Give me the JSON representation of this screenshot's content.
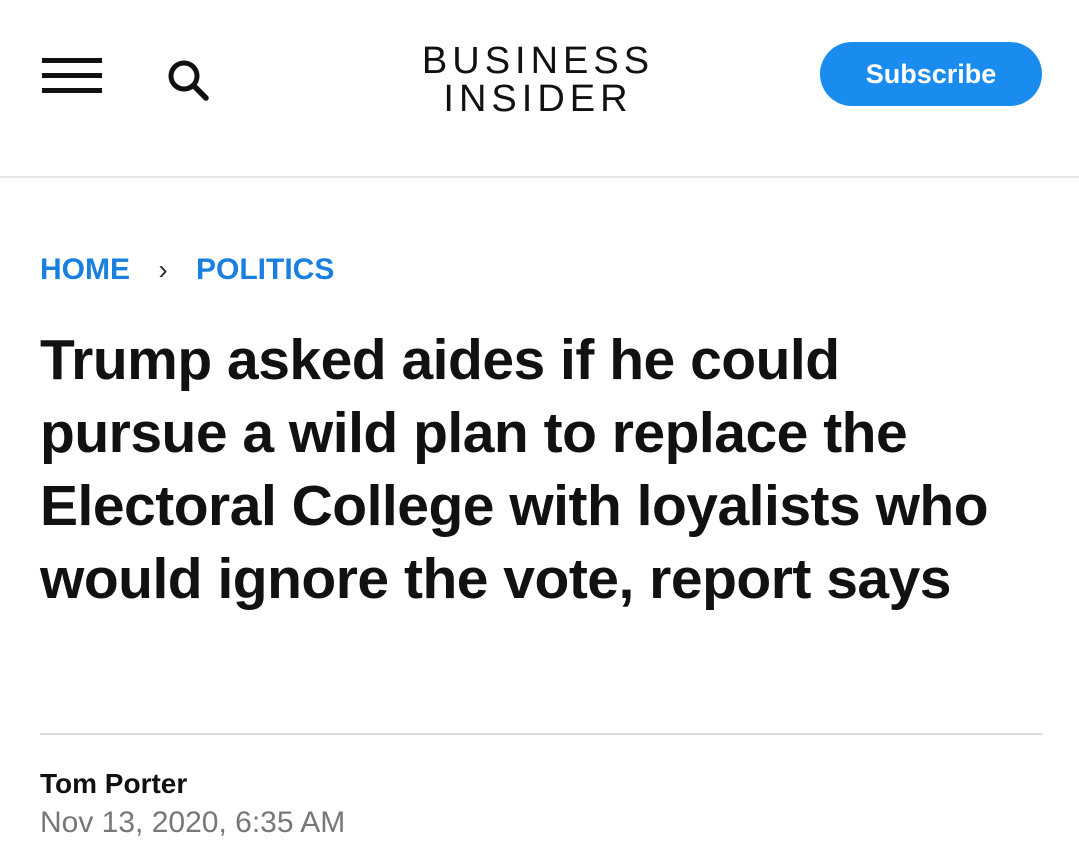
{
  "header": {
    "logo_line1": "BUSINESS",
    "logo_line2": "INSIDER",
    "subscribe_label": "Subscribe",
    "menu_icon": "hamburger-menu-icon",
    "search_icon": "search-icon"
  },
  "breadcrumb": {
    "items": [
      {
        "label": "HOME"
      },
      {
        "label": "POLITICS"
      }
    ],
    "separator": "›"
  },
  "article": {
    "headline": "Trump asked aides if he could pursue a wild plan to replace the Electoral College with loyalists who would ignore the vote, report says",
    "author": "Tom Porter",
    "date": "Nov 13, 2020, 6:35 AM"
  },
  "colors": {
    "accent": "#1a8cf0",
    "link": "#1a80e0",
    "text": "#111111",
    "muted": "#777777"
  }
}
